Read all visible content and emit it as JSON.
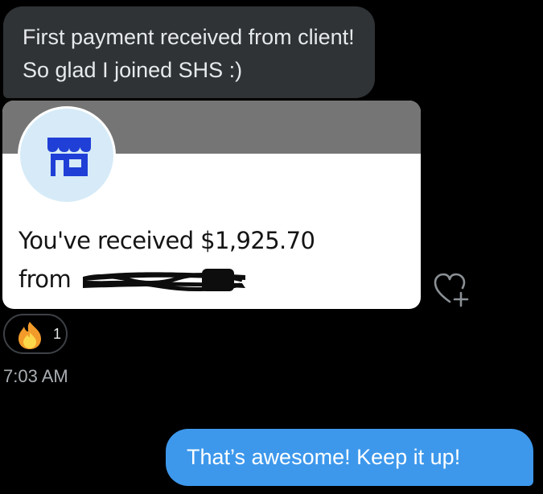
{
  "messages": {
    "received": {
      "text": "First payment received from client! So glad I joined SHS :)"
    },
    "payment_card": {
      "line1": "You've received $1,925.70",
      "line2_prefix": "from",
      "icon": "store-icon",
      "banner_color": "#757575",
      "avatar_bg": "#d6ebf7",
      "icon_color": "#1f3fd6"
    },
    "reaction": {
      "emoji": "fire-icon",
      "count": "1"
    },
    "timestamp": "7:03 AM",
    "sent": {
      "text": "That’s awesome! Keep it up!"
    }
  },
  "colors": {
    "background": "#000000",
    "received_bubble": "#2f3336",
    "sent_bubble": "#3d98ec",
    "timestamp_text": "#a9aeb3"
  },
  "icons": {
    "add_reaction": "heart-plus-icon"
  }
}
